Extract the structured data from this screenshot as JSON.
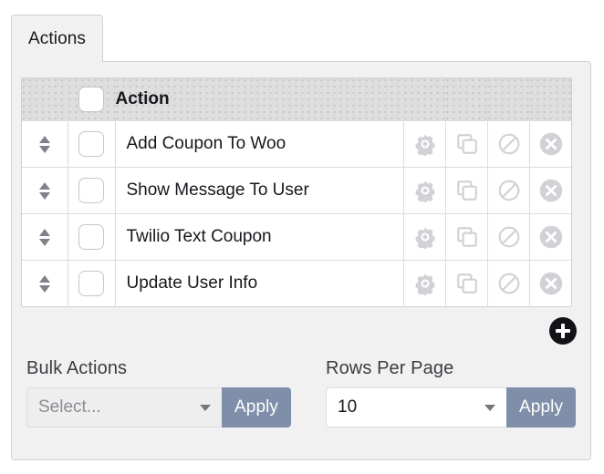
{
  "tabs": [
    {
      "label": "Actions",
      "active": true,
      "name": "tab-actions"
    }
  ],
  "table": {
    "columns": {
      "handle": "",
      "checkbox": "",
      "action": "Action",
      "settings": "",
      "duplicate": "",
      "disable": "",
      "delete": ""
    },
    "header_checkbox_checked": false,
    "rows": [
      {
        "label": "Add Coupon To Woo",
        "checked": false
      },
      {
        "label": "Show Message To User",
        "checked": false
      },
      {
        "label": "Twilio Text Coupon",
        "checked": false
      },
      {
        "label": "Update User Info",
        "checked": false
      }
    ],
    "row_icons": [
      {
        "name": "gear-icon",
        "title": "Settings"
      },
      {
        "name": "copy-icon",
        "title": "Duplicate"
      },
      {
        "name": "ban-icon",
        "title": "Disable"
      },
      {
        "name": "delete-circle-icon",
        "title": "Delete"
      }
    ]
  },
  "add_button": {
    "icon": "plus-icon",
    "label": "Add"
  },
  "bulk_actions": {
    "label": "Bulk Actions",
    "select_value": "Select...",
    "select_is_placeholder": true,
    "apply_label": "Apply"
  },
  "rows_per_page": {
    "label": "Rows Per Page",
    "select_value": "10",
    "apply_label": "Apply"
  },
  "colors": {
    "panel_background": "#f1f1f1",
    "panel_border": "#d2d2d6",
    "table_header_background": "#dededf",
    "row_background": "#ffffff",
    "icon_gray": "#d2d2d6",
    "apply_button": "#7f8fa9",
    "add_button": "#121317",
    "text_primary": "#17181c",
    "text_muted": "#8b8c93"
  }
}
